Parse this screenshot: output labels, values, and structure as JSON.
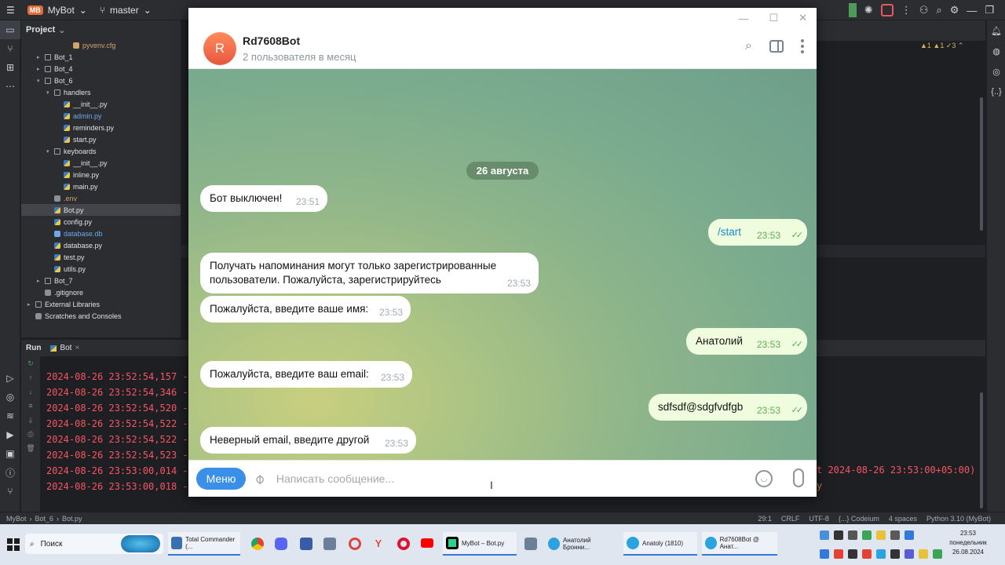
{
  "ide": {
    "project_name": "MyBot",
    "project_initials": "MB",
    "branch": "master",
    "panel_title": "Project",
    "tree": [
      {
        "label": "pyvenv.cfg",
        "depth": 4,
        "type": "cfg",
        "style": "orange"
      },
      {
        "label": "Bot_1",
        "depth": 1,
        "type": "fold",
        "arrow": "▸"
      },
      {
        "label": "Bot_4",
        "depth": 1,
        "type": "fold",
        "arrow": "▸"
      },
      {
        "label": "Bot_6",
        "depth": 1,
        "type": "fold",
        "arrow": "▾"
      },
      {
        "label": "handlers",
        "depth": 2,
        "type": "fold",
        "arrow": "▾"
      },
      {
        "label": "__init__.py",
        "depth": 3,
        "type": "py"
      },
      {
        "label": "admin.py",
        "depth": 3,
        "type": "py",
        "style": "blue"
      },
      {
        "label": "reminders.py",
        "depth": 3,
        "type": "py"
      },
      {
        "label": "start.py",
        "depth": 3,
        "type": "py"
      },
      {
        "label": "keyboards",
        "depth": 2,
        "type": "fold",
        "arrow": "▾"
      },
      {
        "label": "__init__.py",
        "depth": 3,
        "type": "py"
      },
      {
        "label": "inline.py",
        "depth": 3,
        "type": "py"
      },
      {
        "label": "main.py",
        "depth": 3,
        "type": "py"
      },
      {
        "label": ".env",
        "depth": 2,
        "type": "env",
        "style": "orange"
      },
      {
        "label": "Bot.py",
        "depth": 2,
        "type": "py",
        "sel": true
      },
      {
        "label": "config.py",
        "depth": 2,
        "type": "py"
      },
      {
        "label": "database.db",
        "depth": 2,
        "type": "db",
        "style": "blue"
      },
      {
        "label": "database.py",
        "depth": 2,
        "type": "py"
      },
      {
        "label": "test.py",
        "depth": 2,
        "type": "py"
      },
      {
        "label": "utils.py",
        "depth": 2,
        "type": "py"
      },
      {
        "label": "Bot_7",
        "depth": 1,
        "type": "fold",
        "arrow": "▸"
      },
      {
        "label": ".gitignore",
        "depth": 1,
        "type": "env"
      },
      {
        "label": "External Libraries",
        "depth": 0,
        "type": "fold",
        "arrow": "▸"
      },
      {
        "label": "Scratches and Consoles",
        "depth": 0,
        "type": "env"
      }
    ],
    "warnings": "▲1 ▲1 ✓3 ⌃",
    "run_label": "Run",
    "run_tab": "Bot",
    "console_lines": [
      "2024-08-26 23:52:54,157 -",
      "2024-08-26 23:52:54,346 -",
      "2024-08-26 23:52:54,520 -",
      "2024-08-26 23:52:54,522 -",
      "2024-08-26 23:52:54,522 -",
      "2024-08-26 23:52:54,523 -",
      "2024-08-26 23:53:00,014 -",
      "2024-08-26 23:53:00,018 -"
    ],
    "console_tail": "t 2024-08-26 23:53:00+05:00)",
    "console_tail2": "y",
    "breadcrumbs": [
      "MyBot",
      "›",
      "Bot_6",
      "›",
      "Bot.py"
    ],
    "status": [
      "29:1",
      "CRLF",
      "UTF-8",
      "{...} Codeium",
      "4 spaces",
      "Python 3.10 (MyBot)"
    ],
    "colors": {
      "console_error": "#f75464",
      "selected_row": "#43454a"
    }
  },
  "telegram": {
    "bot_name": "Rd7608Bot",
    "avatar_letter": "R",
    "subtitle": "2 пользователя в месяц",
    "date_separator": "26 августа",
    "messages": [
      {
        "dir": "in",
        "text": "Бот выключен!",
        "time": "23:51"
      },
      {
        "dir": "out",
        "text": "/start",
        "time": "23:53",
        "command": true
      },
      {
        "dir": "in",
        "text": "Получать напоминания могут только зарегистрированные пользователи. Пожалуйста, зарегистрируйтесь",
        "time": "23:53"
      },
      {
        "dir": "in",
        "text": "Пожалуйста, введите ваше имя:",
        "time": "23:53"
      },
      {
        "dir": "out",
        "text": "Анатолий",
        "time": "23:53"
      },
      {
        "dir": "in",
        "text": "Пожалуйста, введите ваш email:",
        "time": "23:53"
      },
      {
        "dir": "out",
        "text": "sdfsdf@sdgfvdfgb",
        "time": "23:53"
      },
      {
        "dir": "in",
        "text": "Неверный email, введите другой",
        "time": "23:53"
      }
    ],
    "menu_button": "Меню",
    "input_placeholder": "Написать сообщение...",
    "colors": {
      "accent": "#3a8fe8",
      "outgoing_bubble": "#effdde",
      "avatar": "#e9573f"
    }
  },
  "taskbar": {
    "search_label": "Поиск",
    "apps": [
      {
        "label": "Total Commander (...",
        "icon": "total-commander-icon",
        "color": "#3a6fb0"
      },
      {
        "label": "MyBot – Bot.py",
        "icon": "pycharm-icon",
        "color": "#2b2d30"
      },
      {
        "label": "Анатолий Бронни...",
        "icon": "telegram-icon",
        "color": "#2aa3e0"
      },
      {
        "label": "Anatoly (1810)",
        "icon": "telegram-icon",
        "color": "#2aa3e0"
      },
      {
        "label": "Rd7608Bot @ Анат...",
        "icon": "telegram-icon",
        "color": "#2aa3e0"
      }
    ],
    "time": "23:53",
    "day": "понедельник",
    "date": "26.08.2024"
  }
}
